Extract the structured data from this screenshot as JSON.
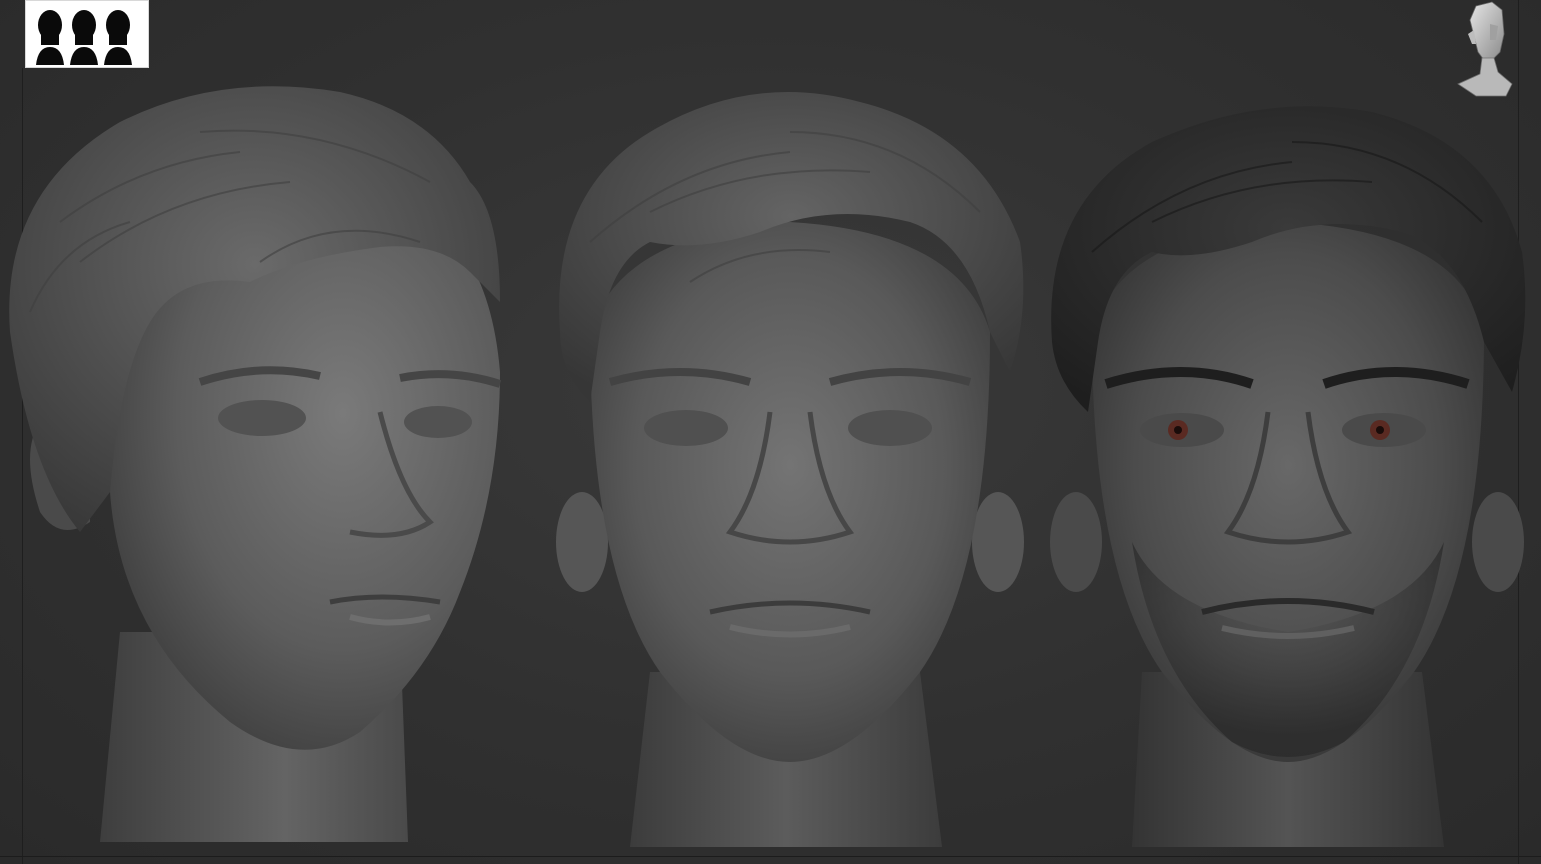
{
  "app": {
    "accent": "#2e2e2e",
    "document_thumbnail_icon": "three-heads-silhouette-icon",
    "navigation_icon": "view-navigation-head-icon"
  },
  "viewport": {
    "background": "#303030",
    "heads": [
      {
        "id": "head-angled",
        "view": "three-quarter",
        "material": "matcap-clay",
        "tone": "#6c6c6c",
        "hair_tone": "#585858"
      },
      {
        "id": "head-front",
        "view": "front",
        "material": "matcap-clay",
        "tone": "#666666",
        "hair_tone": "#545454"
      },
      {
        "id": "head-front-textured",
        "view": "front",
        "material": "polypaint",
        "tone": "#555555",
        "hair_tone": "#2c2c2c",
        "eye_color": "#5a2a22"
      }
    ]
  }
}
